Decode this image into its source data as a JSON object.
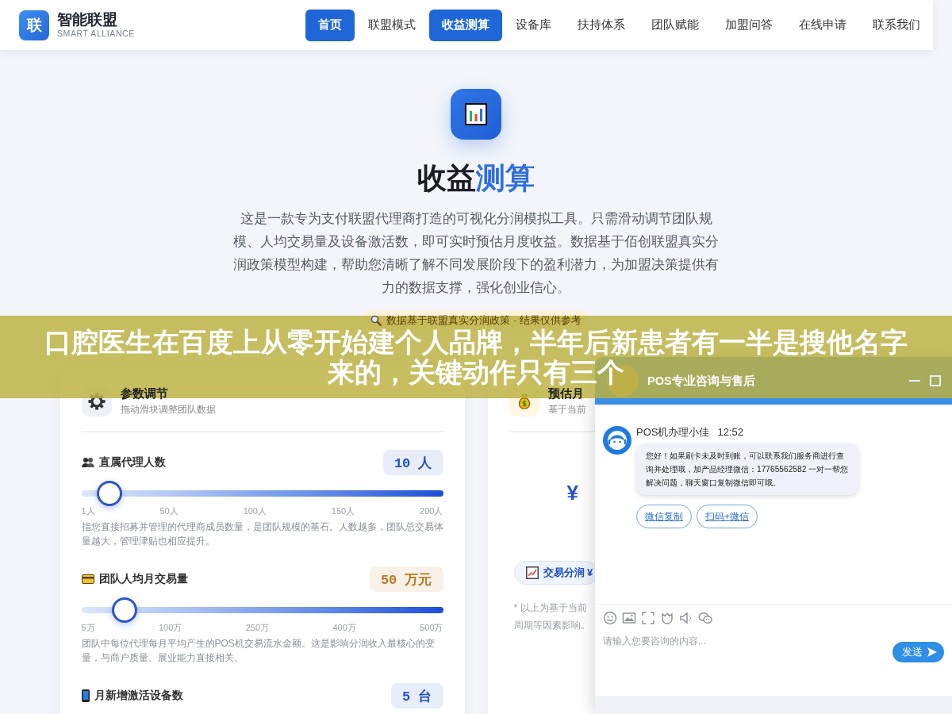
{
  "header": {
    "logo_mark": "联",
    "brand_name": "智能联盟",
    "brand_tagline": "SMART ALLIANCE",
    "nav": [
      {
        "label": "首页",
        "selected": true
      },
      {
        "label": "联盟模式",
        "selected": false
      },
      {
        "label": "收益测算",
        "selected": true
      },
      {
        "label": "设备库",
        "selected": false
      },
      {
        "label": "扶持体系",
        "selected": false
      },
      {
        "label": "团队赋能",
        "selected": false
      },
      {
        "label": "加盟问答",
        "selected": false
      },
      {
        "label": "在线申请",
        "selected": false
      },
      {
        "label": "联系我们",
        "selected": false
      }
    ]
  },
  "hero": {
    "title": "收益",
    "title_accent": "测算",
    "description": "这是一款专为支付联盟代理商打造的可视化分润模拟工具。只需滑动调节团队规模、人均交易量及设备激活数，即可实时预估月度收益。数据基于佰创联盟真实分润政策模型构建，帮助您清晰了解不同发展阶段下的盈利潜力，为加盟决策提供有力的数据支撑，强化创业信心。",
    "notice": "数据基于联盟真实分润政策 · 结果仅供参考"
  },
  "parameters_card": {
    "title": "参数调节",
    "subtitle": "拖动滑块调整团队数据",
    "items": [
      {
        "kind": "people",
        "label": "直属代理人数",
        "value": "10 人",
        "color": "#1e4fc7",
        "level": 0.045,
        "ticks": [
          "1人",
          "50人",
          "100人",
          "150人",
          "200人"
        ],
        "description": "指您直接招募并管理的代理商成员数量，是团队规模的基石。人数越多，团队总交易体量越大，管理津贴也相应提升。"
      },
      {
        "kind": "card",
        "label": "团队人均月交易量",
        "value": "50 万元",
        "color": "#b7791f",
        "level": 0.091,
        "ticks": [
          "5万",
          "100万",
          "250万",
          "400万",
          "500万"
        ],
        "description": "团队中每位代理每月平均产生的POS机交易流水金额。这是影响分润收入最核心的变量，与商户质量、展业能力直接相关。"
      },
      {
        "kind": "phone",
        "label": "月新增激活设备数",
        "value": "5 台",
        "color": "#1e4fc7"
      }
    ]
  },
  "results_card": {
    "title": "预估月",
    "subtitle": "基于当前",
    "currency": "¥",
    "breakdown": "交易分润 ¥",
    "note_lines": [
      "* 以上为基于当前",
      "周期等因素影响。"
    ]
  },
  "chat": {
    "title": "POS专业咨询与售后",
    "messages": [
      {
        "sender": "POS机办理小佳",
        "time": "12:52",
        "text": "您好！如果刷卡未及时到账，可以联系我们服务商进行查询并处理哦，加产品经理微信：17765562582 一对一帮您解决问题，聊天窗口复制微信即可哦。",
        "actions": [
          "微信复制",
          "扫码+微信"
        ]
      }
    ],
    "input": {
      "placeholder": "请输入您要咨询的内容..."
    },
    "send_label": "发送"
  },
  "overlay_banner": {
    "text": "口腔医生在百度上从零开始建个人品牌，半年后新患者有一半是搜他名字来的，关键动作只有三个"
  }
}
